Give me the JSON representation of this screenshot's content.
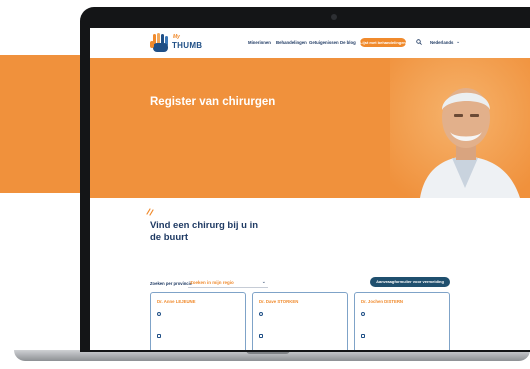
{
  "nav": {
    "logo_small": "My",
    "logo_big": "THUMB",
    "items": [
      "Minerinnen",
      "Behandelingen",
      "Getuigenissen",
      "De blog"
    ],
    "cta_label": "Lijst met behandelingen",
    "lang_label": "Nederlands"
  },
  "hero": {
    "title": "Register van chirurgen"
  },
  "intro": {
    "title": "Vind een chirurg bij u in de buurt"
  },
  "filter": {
    "label": "Zoeken per provincie",
    "selected": "Zoeken in mijn regio",
    "request_label": "Aanvraagformulier voor vermelding"
  },
  "cards": [
    {
      "name": "Dr. Anne LEJEUNE"
    },
    {
      "name": "Dr. Dave STORKEN"
    },
    {
      "name": "Dr. Jochen DISTERN"
    }
  ],
  "colors": {
    "brand_orange": "#f08a2c",
    "brand_navy": "#1f3a63",
    "button_navy": "#1f4f6e"
  },
  "icons": [
    "hand-logo-icon",
    "search-icon",
    "chevron-down-icon",
    "pin-icon",
    "phone-icon",
    "accent-tick-icon"
  ]
}
